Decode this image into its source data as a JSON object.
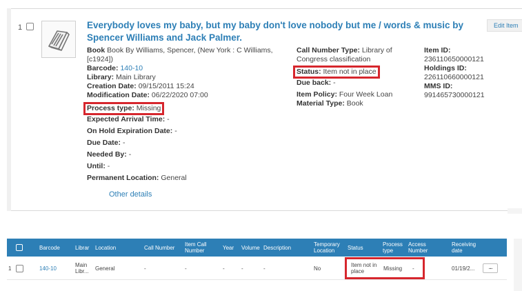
{
  "record": {
    "row_number": "1",
    "title": "Everybody loves my baby, but my baby don't love nobody but me / words & music by Spencer Williams and Jack Palmer.",
    "edit_item_label": "Edit Item",
    "col1": {
      "book_line": "Book By Williams, Spencer, (New York : C Williams, [c1924])",
      "barcode_label": "Barcode:",
      "barcode_value": "140-10",
      "library_label": "Library:",
      "library_value": "Main Library",
      "creation_label": "Creation Date:",
      "creation_value": "09/15/2011 15:24",
      "modification_label": "Modification Date:",
      "modification_value": "06/22/2020 07:00",
      "process_label": "Process type:",
      "process_value": "Missing",
      "arrival_label": "Expected Arrival Time:",
      "arrival_value": "-",
      "hold_label": "On Hold Expiration Date:",
      "hold_value": "-",
      "due_label": "Due Date:",
      "due_value": "-",
      "needed_label": "Needed By:",
      "needed_value": "-",
      "until_label": "Until:",
      "until_value": "-",
      "permloc_label": "Permanent Location:",
      "permloc_value": "General"
    },
    "col2": {
      "callnum_type_label": "Call Number Type:",
      "callnum_type_value": "Library of Congress classification",
      "status_label": "Status:",
      "status_value": "Item not in place",
      "dueback_label": "Due back:",
      "dueback_value": "-",
      "policy_label": "Item Policy:",
      "policy_value": "Four Week Loan",
      "material_label": "Material Type:",
      "material_value": "Book"
    },
    "col3": {
      "item_id_label": "Item ID:",
      "item_id_value": "236110650000121",
      "holdings_id_label": "Holdings ID:",
      "holdings_id_value": "226110660000121",
      "mms_id_label": "MMS ID:",
      "mms_id_value": "991465730000121"
    },
    "other_details": "Other details"
  },
  "table": {
    "headers": {
      "barcode": "Barcode",
      "library": "Librar",
      "location": "Location",
      "call_number": "Call Number",
      "item_call_number": "Item Call Number",
      "year": "Year",
      "volume": "Volume",
      "description": "Description",
      "temporary_location": "Temporary Location",
      "status": "Status",
      "process_type": "Process type",
      "access_number": "Access Number",
      "receiving_date": "Receiving date"
    },
    "rows": [
      {
        "row_number": "1",
        "barcode": "140-10",
        "library": "Main Libr...",
        "location": "General",
        "call_number": "-",
        "item_call_number": "-",
        "year": "-",
        "volume": "-",
        "description": "-",
        "temporary_location": "No",
        "status": "Item not in place",
        "process_type": "Missing",
        "access_number": "-",
        "receiving_date": "01/19/2...",
        "more_label": "..."
      }
    ]
  },
  "colors": {
    "accent": "#2d7fb6",
    "highlight": "#d6262d"
  }
}
